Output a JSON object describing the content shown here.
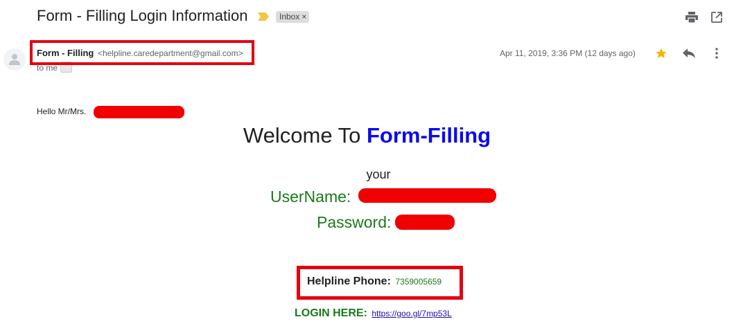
{
  "email": {
    "subject": "Form - Filling Login Information",
    "label_chip": "Inbox",
    "label_chip_close": "×",
    "sender_name": "Form - Filling",
    "sender_email": "<helpline.caredepartment@gmail.com>",
    "recipient": "to me",
    "date": "Apr 11, 2019, 3:36 PM (12 days ago)"
  },
  "body": {
    "greeting": "Hello Mr/Mrs.",
    "welcome_prefix": "Welcome To ",
    "welcome_brand": "Form-Filling",
    "your": "your",
    "username_label": "UserName:",
    "password_label": "Password:",
    "helpline_label": "Helpline Phone:",
    "helpline_number": "7359005659",
    "login_label": "LOGIN HERE:",
    "login_link": "https://goo.gl/7mp53L"
  },
  "icons": {
    "label_marker": "label-important-icon",
    "print": "print-icon",
    "open_new_window": "open-in-new-window-icon",
    "avatar": "person-avatar-icon",
    "star": "star-icon",
    "reply": "reply-icon",
    "more": "more-vertical-icon"
  },
  "colors": {
    "annotation_red": "#e4000f",
    "redaction_red": "#f00000",
    "brand_blue": "#0a0aee",
    "label_green": "#1a7a1a",
    "star_yellow": "#f4b400",
    "link_blue": "#1a0dab"
  }
}
